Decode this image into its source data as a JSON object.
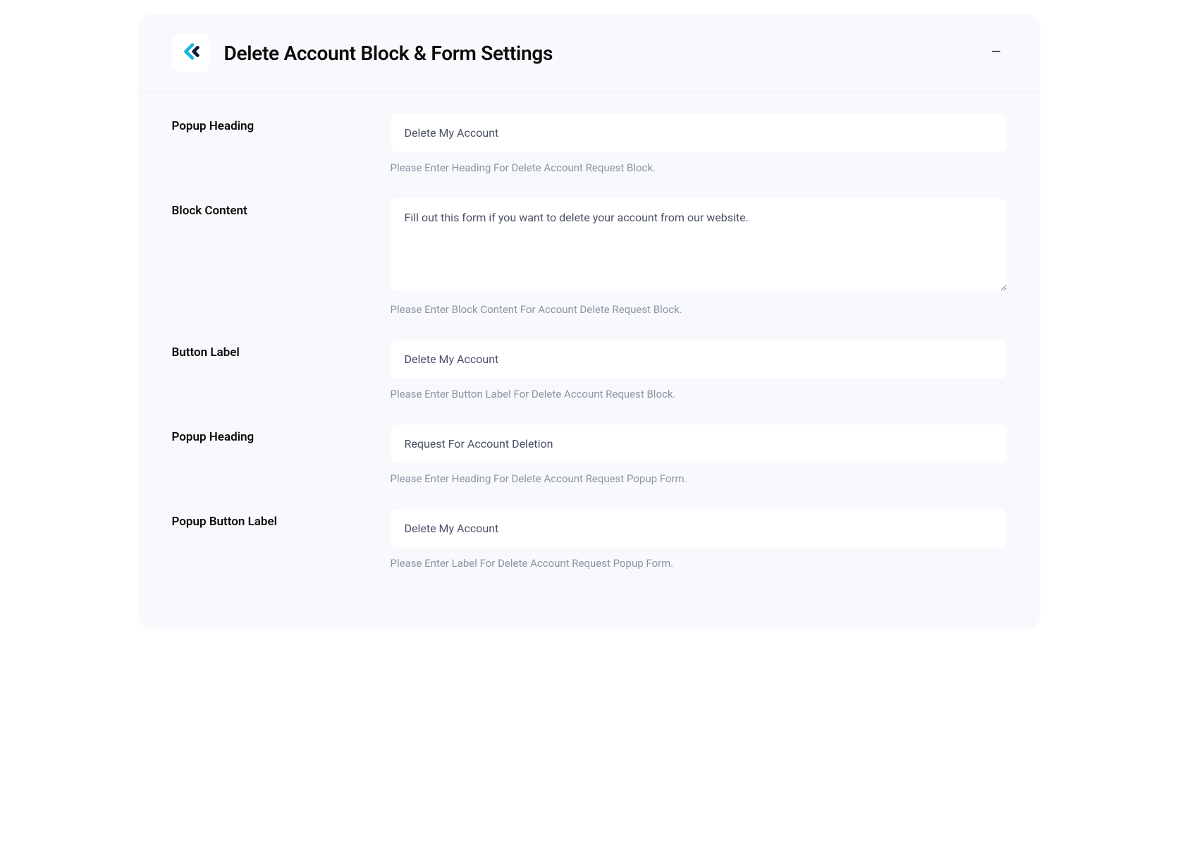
{
  "header": {
    "title": "Delete Account Block & Form Settings"
  },
  "fields": {
    "popup_heading_1": {
      "label": "Popup Heading",
      "value": "Delete My Account",
      "help": "Please Enter Heading For Delete Account Request Block."
    },
    "block_content": {
      "label": "Block Content",
      "value": "Fill out this form if you want to delete your account from our website.",
      "help": "Please Enter Block Content For Account Delete Request Block."
    },
    "button_label": {
      "label": "Button Label",
      "value": "Delete My Account",
      "help": "Please Enter Button Label For Delete Account Request Block."
    },
    "popup_heading_2": {
      "label": "Popup Heading",
      "value": "Request For Account Deletion",
      "help": "Please Enter Heading For Delete Account Request Popup Form."
    },
    "popup_button_label": {
      "label": "Popup Button Label",
      "value": "Delete My Account",
      "help": "Please Enter Label For Delete Account Request Popup Form."
    }
  }
}
